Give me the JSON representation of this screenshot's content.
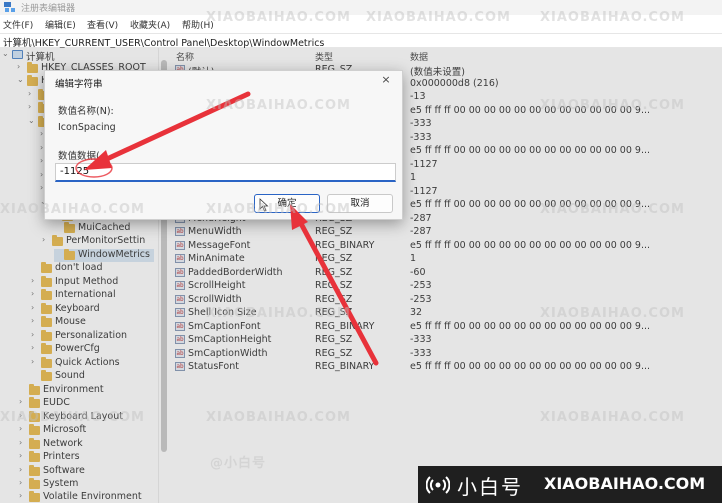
{
  "window": {
    "title": "注册表编辑器"
  },
  "menu": [
    "文件(F)",
    "编辑(E)",
    "查看(V)",
    "收藏夹(A)",
    "帮助(H)"
  ],
  "address": "计算机\\HKEY_CURRENT_USER\\Control Panel\\Desktop\\WindowMetrics",
  "tree": {
    "root": "计算机",
    "items": [
      {
        "label": "HKEY_CLASSES_ROOT"
      },
      {
        "label": "H"
      },
      {
        "label": "MuiCached"
      },
      {
        "label": "PerMonitorSettin"
      },
      {
        "label": "WindowMetrics"
      },
      {
        "label": "don't load"
      },
      {
        "label": "Input Method"
      },
      {
        "label": "International"
      },
      {
        "label": "Keyboard"
      },
      {
        "label": "Mouse"
      },
      {
        "label": "Personalization"
      },
      {
        "label": "PowerCfg"
      },
      {
        "label": "Quick Actions"
      },
      {
        "label": "Sound"
      },
      {
        "label": "Environment"
      },
      {
        "label": "EUDC"
      },
      {
        "label": "Keyboard Layout"
      },
      {
        "label": "Microsoft"
      },
      {
        "label": "Network"
      },
      {
        "label": "Printers"
      },
      {
        "label": "Software"
      },
      {
        "label": "System"
      },
      {
        "label": "Volatile Environment"
      }
    ]
  },
  "list": {
    "columns": [
      "名称",
      "类型",
      "数据"
    ],
    "rows": [
      {
        "name": "(默认)",
        "type": "REG_SZ",
        "data": "(数值未设置)"
      },
      {
        "name": "",
        "type": "",
        "data": "0x000000d8 (216)"
      },
      {
        "name": "",
        "type": "",
        "data": "-13"
      },
      {
        "name": "",
        "type": "",
        "data": "e5 ff ff ff 00 00 00 00 00 00 00 00 00 00 00 00 9..."
      },
      {
        "name": "",
        "type": "",
        "data": "-333"
      },
      {
        "name": "",
        "type": "",
        "data": "-333"
      },
      {
        "name": "",
        "type": "",
        "data": "e5 ff ff ff 00 00 00 00 00 00 00 00 00 00 00 00 9..."
      },
      {
        "name": "",
        "type": "",
        "data": "-1127"
      },
      {
        "name": "",
        "type": "",
        "data": "1"
      },
      {
        "name": "",
        "type": "",
        "data": "-1127"
      },
      {
        "name": "",
        "type": "",
        "data": "e5 ff ff ff 00 00 00 00 00 00 00 00 00 00 00 00 9..."
      },
      {
        "name": "MenuHeight",
        "type": "REG_SZ",
        "data": "-287"
      },
      {
        "name": "MenuWidth",
        "type": "REG_SZ",
        "data": "-287"
      },
      {
        "name": "MessageFont",
        "type": "REG_BINARY",
        "data": "e5 ff ff ff 00 00 00 00 00 00 00 00 00 00 00 00 9..."
      },
      {
        "name": "MinAnimate",
        "type": "REG_SZ",
        "data": "1"
      },
      {
        "name": "PaddedBorderWidth",
        "type": "REG_SZ",
        "data": "-60"
      },
      {
        "name": "ScrollHeight",
        "type": "REG_SZ",
        "data": "-253"
      },
      {
        "name": "ScrollWidth",
        "type": "REG_SZ",
        "data": "-253"
      },
      {
        "name": "Shell Icon Size",
        "type": "REG_SZ",
        "data": "32"
      },
      {
        "name": "SmCaptionFont",
        "type": "REG_BINARY",
        "data": "e5 ff ff ff 00 00 00 00 00 00 00 00 00 00 00 00 9..."
      },
      {
        "name": "SmCaptionHeight",
        "type": "REG_SZ",
        "data": "-333"
      },
      {
        "name": "SmCaptionWidth",
        "type": "REG_SZ",
        "data": "-333"
      },
      {
        "name": "StatusFont",
        "type": "REG_BINARY",
        "data": "e5 ff ff ff 00 00 00 00 00 00 00 00 00 00 00 00 9..."
      }
    ]
  },
  "dialog": {
    "title": "编辑字符串",
    "name_label": "数值名称(N):",
    "name_value": "IconSpacing",
    "data_label": "数值数据(",
    "data_value": "-1125",
    "ok_label": "确定",
    "cancel_label": "取消",
    "close_glyph": "×"
  },
  "icons": {
    "string_value": "ab",
    "expand": "›",
    "collapse": "⌄"
  },
  "colors": {
    "accent": "#2a64c5",
    "arrow": "#e8323a",
    "folder": "#e8b43a"
  },
  "watermark": {
    "brand_cn": "小白号",
    "brand_en": "XIAOBAIHAO.COM",
    "small_cn": "@小白号"
  }
}
